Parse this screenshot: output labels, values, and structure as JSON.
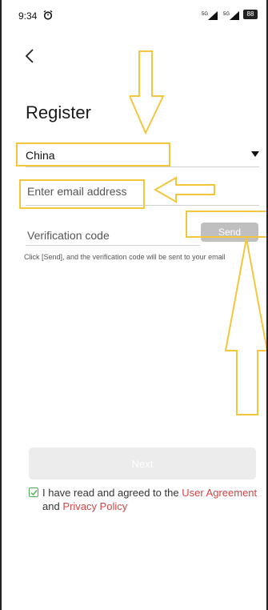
{
  "status": {
    "time": "9:34",
    "signal1": "5G",
    "signal2": "5G",
    "battery": "88"
  },
  "nav": {
    "back_icon": "chevron-left-icon"
  },
  "page": {
    "title": "Register"
  },
  "form": {
    "country": "China",
    "email_placeholder": "Enter email address",
    "code_placeholder": "Verification code",
    "send_label": "Send",
    "hint": "Click [Send], and the verification code will be sent to your email"
  },
  "next": {
    "label": "Next"
  },
  "agreement": {
    "text_prefix": "I have read and agreed to the",
    "user_agreement": "User Agreement",
    "and": "and",
    "privacy_policy": "Privacy Policy"
  },
  "colors": {
    "annotation": "#f4c63d",
    "link": "#d64545",
    "checkbox": "#4caf50"
  }
}
